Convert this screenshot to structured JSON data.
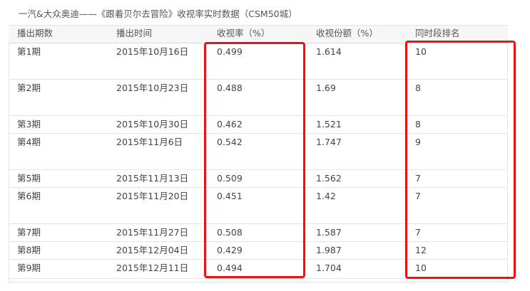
{
  "caption": "一汽&大众奥迪——《跟着贝尔去冒险》收视率实时数据（CSM50城）",
  "table": {
    "headers": [
      "播出期数",
      "播出时间",
      "收视率（%）",
      "收视份额（%）",
      "同时段排名"
    ],
    "rows": [
      [
        "第1期",
        "2015年10月16日",
        "0.499",
        "1.614",
        "10"
      ],
      [
        "第2期",
        "2015年10月23日",
        "0.488",
        "1.69",
        "8"
      ],
      [
        "第3期",
        "2015年10月30日",
        "0.462",
        "1.521",
        "8"
      ],
      [
        "第4期",
        "2015年11月6日",
        "0.542",
        "1.747",
        "9"
      ],
      [
        "第5期",
        "2015年11月13日",
        "0.509",
        "1.562",
        "7"
      ],
      [
        "第6期",
        "2015年11月20日",
        "0.451",
        "1.42",
        "7"
      ],
      [
        "第7期",
        "2015年11月27日",
        "0.508",
        "1.587",
        "7"
      ],
      [
        "第8期",
        "2015年12月04日",
        "0.429",
        "1.987",
        "12"
      ],
      [
        "第9期",
        "2015年12月11日",
        "0.494",
        "1.704",
        "10"
      ]
    ]
  },
  "highlight_color": "#ee1111"
}
